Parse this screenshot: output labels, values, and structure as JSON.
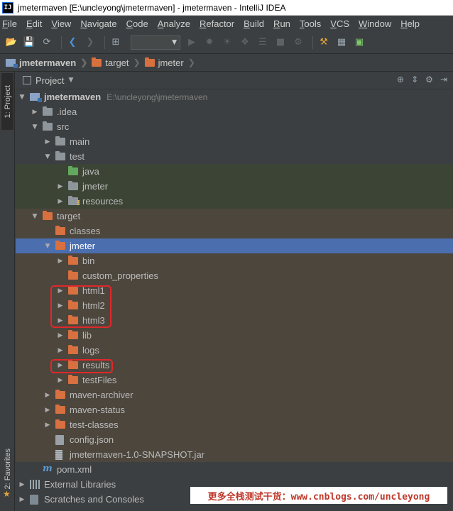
{
  "titlebar": {
    "app_icon_text": "IJ",
    "title": "jmetermaven [E:\\uncleyong\\jmetermaven] - jmetermaven - IntelliJ IDEA"
  },
  "menu": [
    "File",
    "Edit",
    "View",
    "Navigate",
    "Code",
    "Analyze",
    "Refactor",
    "Build",
    "Run",
    "Tools",
    "VCS",
    "Window",
    "Help"
  ],
  "breadcrumb": [
    "jmetermaven",
    "target",
    "jmeter"
  ],
  "side_tabs": {
    "project": "1: Project",
    "favorites": "2: Favorites"
  },
  "panel": {
    "title": "Project"
  },
  "tree": [
    {
      "label": "jmetermaven",
      "path": "E:\\uncleyong\\jmetermaven",
      "depth": 0,
      "arrow": "down",
      "icon": "module",
      "bg": "",
      "bold": true
    },
    {
      "label": ".idea",
      "depth": 1,
      "arrow": "right",
      "icon": "grey"
    },
    {
      "label": "src",
      "depth": 1,
      "arrow": "down",
      "icon": "grey"
    },
    {
      "label": "main",
      "depth": 2,
      "arrow": "right",
      "icon": "grey"
    },
    {
      "label": "test",
      "depth": 2,
      "arrow": "down",
      "icon": "grey"
    },
    {
      "label": "java",
      "depth": 3,
      "arrow": "",
      "icon": "green",
      "bg": "test"
    },
    {
      "label": "jmeter",
      "depth": 3,
      "arrow": "right",
      "icon": "grey",
      "bg": "test"
    },
    {
      "label": "resources",
      "depth": 3,
      "arrow": "right",
      "icon": "resfolder",
      "bg": "test"
    },
    {
      "label": "target",
      "depth": 1,
      "arrow": "down",
      "icon": "orange",
      "bg": "target"
    },
    {
      "label": "classes",
      "depth": 2,
      "arrow": "",
      "icon": "orange",
      "bg": "target"
    },
    {
      "label": "jmeter",
      "depth": 2,
      "arrow": "down",
      "icon": "orange",
      "bg": "selected"
    },
    {
      "label": "bin",
      "depth": 3,
      "arrow": "right",
      "icon": "orange",
      "bg": "target"
    },
    {
      "label": "custom_properties",
      "depth": 3,
      "arrow": "",
      "icon": "orange",
      "bg": "target"
    },
    {
      "label": "html1",
      "depth": 3,
      "arrow": "right",
      "icon": "orange",
      "bg": "target"
    },
    {
      "label": "html2",
      "depth": 3,
      "arrow": "right",
      "icon": "orange",
      "bg": "target"
    },
    {
      "label": "html3",
      "depth": 3,
      "arrow": "right",
      "icon": "orange",
      "bg": "target"
    },
    {
      "label": "lib",
      "depth": 3,
      "arrow": "right",
      "icon": "orange",
      "bg": "target"
    },
    {
      "label": "logs",
      "depth": 3,
      "arrow": "right",
      "icon": "orange",
      "bg": "target"
    },
    {
      "label": "results",
      "depth": 3,
      "arrow": "right",
      "icon": "orange",
      "bg": "target"
    },
    {
      "label": "testFiles",
      "depth": 3,
      "arrow": "right",
      "icon": "orange",
      "bg": "target"
    },
    {
      "label": "maven-archiver",
      "depth": 2,
      "arrow": "right",
      "icon": "orange",
      "bg": "target"
    },
    {
      "label": "maven-status",
      "depth": 2,
      "arrow": "right",
      "icon": "orange",
      "bg": "target"
    },
    {
      "label": "test-classes",
      "depth": 2,
      "arrow": "right",
      "icon": "orange",
      "bg": "target"
    },
    {
      "label": "config.json",
      "depth": 2,
      "arrow": "",
      "icon": "file",
      "bg": "target"
    },
    {
      "label": "jmetermaven-1.0-SNAPSHOT.jar",
      "depth": 2,
      "arrow": "",
      "icon": "jar",
      "bg": "target"
    },
    {
      "label": "pom.xml",
      "depth": 1,
      "arrow": "",
      "icon": "maven"
    },
    {
      "label": "External Libraries",
      "depth": 0,
      "arrow": "right",
      "icon": "lib"
    },
    {
      "label": "Scratches and Consoles",
      "depth": 0,
      "arrow": "right",
      "icon": "scratch"
    }
  ],
  "watermark": "更多全栈测试干货：www.cnblogs.com/uncleyong",
  "colors": {
    "selection": "#4b6eaf",
    "folder_orange": "#d8703f",
    "folder_green": "#62a85e",
    "highlight_box": "#e0282a"
  }
}
